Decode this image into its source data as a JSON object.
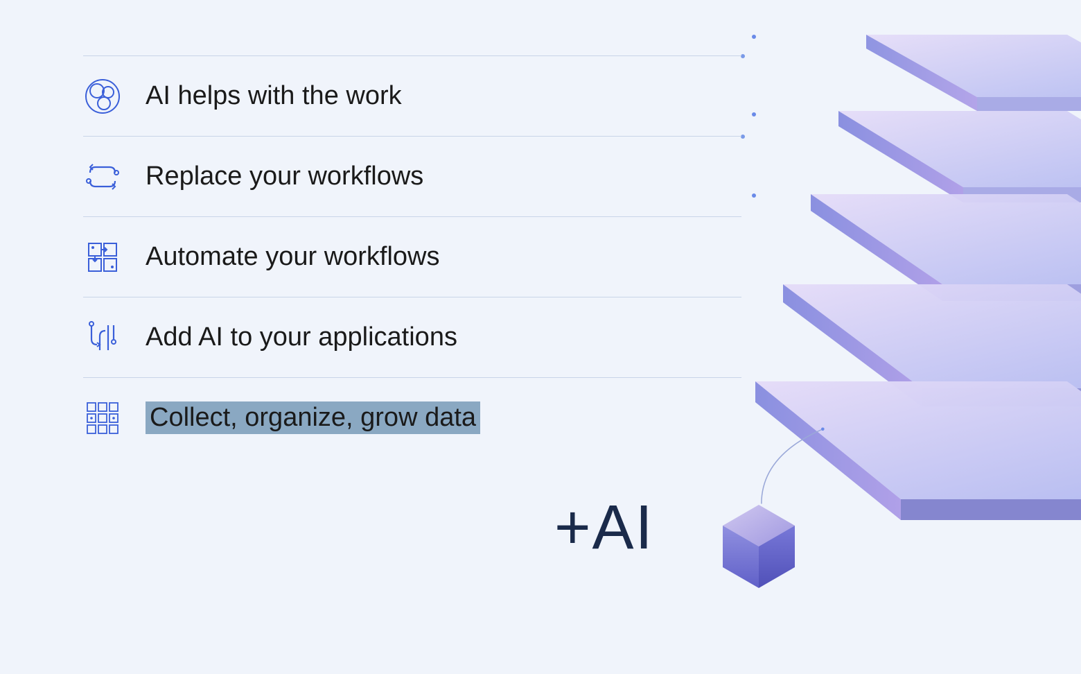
{
  "rows": [
    {
      "label": "AI helps with the work",
      "icon": "ai-helps-icon",
      "highlighted": false
    },
    {
      "label": "Replace your workflows",
      "icon": "replace-workflows-icon",
      "highlighted": false
    },
    {
      "label": "Automate your workflows",
      "icon": "automate-workflows-icon",
      "highlighted": false
    },
    {
      "label": "Add AI to your applications",
      "icon": "add-ai-icon",
      "highlighted": false
    },
    {
      "label": "Collect, organize, grow data",
      "icon": "collect-data-icon",
      "highlighted": true
    }
  ],
  "footer_label": "+AI",
  "colors": {
    "icon_stroke": "#3a5fd9",
    "text": "#1a1a1a",
    "highlight_bg": "#8aa8c2",
    "divider": "#c8d4e8",
    "layer_gradient_start": "#c9b8f0",
    "layer_gradient_end": "#8090e8",
    "layer_edge": "#6a7ce0",
    "cube_face_light": "#b0a8e8",
    "cube_face_dark": "#6a6ad8"
  }
}
